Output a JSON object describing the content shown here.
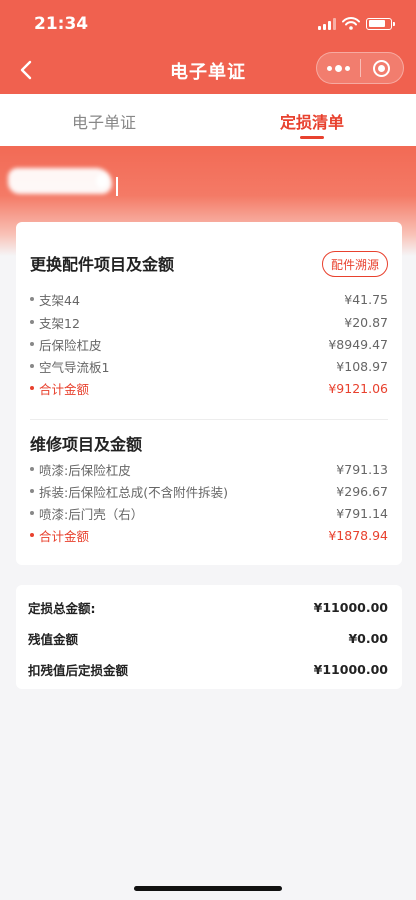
{
  "status_bar": {
    "time": "21:34"
  },
  "nav": {
    "title": "电子单证"
  },
  "tabs": [
    {
      "label": "电子单证",
      "active": false
    },
    {
      "label": "定损清单",
      "active": true
    }
  ],
  "parts": {
    "title": "更换配件项目及金额",
    "trace_button": "配件溯源",
    "items": [
      {
        "name": "支架44",
        "amount": "¥41.75"
      },
      {
        "name": "支架12",
        "amount": "¥20.87"
      },
      {
        "name": "后保险杠皮",
        "amount": "¥8949.47"
      },
      {
        "name": "空气导流板1",
        "amount": "¥108.97"
      }
    ],
    "total": {
      "name": "合计金额",
      "amount": "¥9121.06"
    }
  },
  "repairs": {
    "title": "维修项目及金额",
    "items": [
      {
        "name": "喷漆:后保险杠皮",
        "amount": "¥791.13"
      },
      {
        "name": "拆装:后保险杠总成(不含附件拆装)",
        "amount": "¥296.67"
      },
      {
        "name": "喷漆:后门壳（右）",
        "amount": "¥791.14"
      }
    ],
    "total": {
      "name": "合计金额",
      "amount": "¥1878.94"
    }
  },
  "summary": [
    {
      "name": "定损总金额:",
      "amount": "¥11000.00"
    },
    {
      "name": "残值金额",
      "amount": "¥0.00"
    },
    {
      "name": "扣残值后定损金额",
      "amount": "¥11000.00"
    }
  ],
  "colors": {
    "brand": "#f0614f",
    "accent": "#e8412e"
  }
}
